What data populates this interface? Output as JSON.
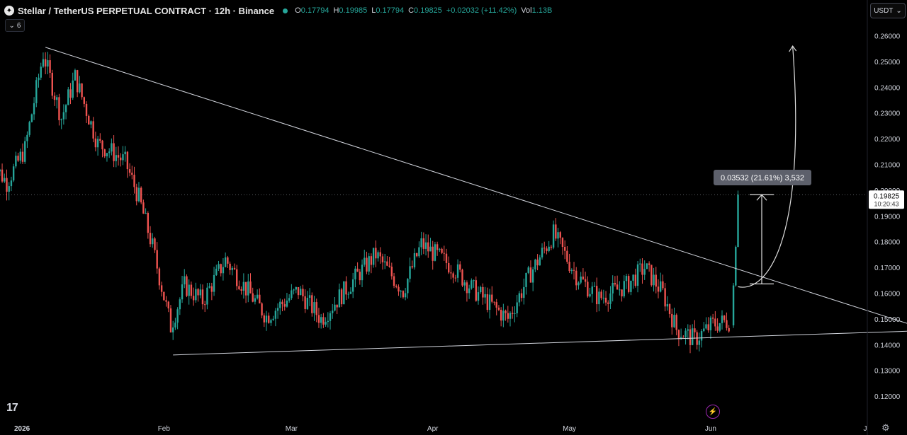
{
  "header": {
    "logo_icon": "stellar-logo-icon",
    "title": "Stellar / TetherUS PERPETUAL CONTRACT · 12h · Binance",
    "status_dot_color": "#26a69a",
    "ohlc": {
      "o_label": "O",
      "o": "0.17794",
      "h_label": "H",
      "h": "0.19985",
      "l_label": "L",
      "l": "0.17794",
      "c_label": "C",
      "c": "0.19825",
      "change": "+0.02032 (+11.42%)",
      "vol_label": "Vol",
      "vol": "1.13B"
    }
  },
  "indicator_toggle": {
    "icon": "chevron-down-icon",
    "count": "6"
  },
  "currency_select": {
    "value": "USDT",
    "icon": "chevron-down-icon"
  },
  "price_tag": {
    "price": "0.19825",
    "countdown": "10:20:43"
  },
  "measure_label": "0.03532 (21.61%) 3,532",
  "tv_logo": "17",
  "colors": {
    "up": "#26a69a",
    "down": "#ef5350",
    "trendline": "#d1d4dc",
    "background": "#000000"
  },
  "chart_data": {
    "type": "candlestick",
    "symbol": "XLMUSDT.P",
    "timeframe": "12h",
    "y_axis": {
      "ticks": [
        "0.26000",
        "0.25000",
        "0.24000",
        "0.23000",
        "0.22000",
        "0.21000",
        "0.20000",
        "0.19000",
        "0.18000",
        "0.17000",
        "0.16000",
        "0.15000",
        "0.14000",
        "0.13000",
        "0.12000"
      ],
      "range": [
        0.1155,
        0.2655
      ]
    },
    "x_axis": {
      "ticks": [
        "2026",
        "Feb",
        "Mar",
        "Apr",
        "May",
        "Jun",
        "J"
      ]
    },
    "current_price": 0.19825,
    "ohlc_anchors": [
      [
        "2025-12-25",
        0.213
      ],
      [
        "2025-12-29",
        0.203
      ],
      [
        "2026-01-02",
        0.216
      ],
      [
        "2026-01-06",
        0.253
      ],
      [
        "2026-01-10",
        0.228
      ],
      [
        "2026-01-13",
        0.244
      ],
      [
        "2026-01-18",
        0.218
      ],
      [
        "2026-01-21",
        0.215
      ],
      [
        "2026-01-24",
        0.211
      ],
      [
        "2026-01-27",
        0.197
      ],
      [
        "2026-01-30",
        0.178
      ],
      [
        "2026-02-03",
        0.147
      ],
      [
        "2026-02-06",
        0.163
      ],
      [
        "2026-02-10",
        0.157
      ],
      [
        "2026-02-15",
        0.173
      ],
      [
        "2026-02-19",
        0.163
      ],
      [
        "2026-02-24",
        0.151
      ],
      [
        "2026-03-03",
        0.161
      ],
      [
        "2026-03-08",
        0.15
      ],
      [
        "2026-03-16",
        0.167
      ],
      [
        "2026-03-20",
        0.175
      ],
      [
        "2026-03-26",
        0.161
      ],
      [
        "2026-03-30",
        0.179
      ],
      [
        "2026-04-06",
        0.17
      ],
      [
        "2026-04-10",
        0.162
      ],
      [
        "2026-04-18",
        0.15
      ],
      [
        "2026-04-23",
        0.168
      ],
      [
        "2026-04-28",
        0.183
      ],
      [
        "2026-05-03",
        0.167
      ],
      [
        "2026-05-08",
        0.158
      ],
      [
        "2026-05-14",
        0.163
      ],
      [
        "2026-05-18",
        0.17
      ],
      [
        "2026-05-22",
        0.16
      ],
      [
        "2026-05-25",
        0.146
      ],
      [
        "2026-05-29",
        0.142
      ],
      [
        "2026-06-02",
        0.148
      ],
      [
        "2026-06-05",
        0.149
      ]
    ],
    "last_candles": [
      {
        "date": "2026-06-06",
        "o": 0.1475,
        "h": 0.164,
        "l": 0.1465,
        "c": 0.163
      },
      {
        "date": "2026-06-06 12:00",
        "o": 0.163,
        "h": 0.1785,
        "l": 0.1625,
        "c": 0.178
      },
      {
        "date": "2026-06-07",
        "o": 0.17794,
        "h": 0.19985,
        "l": 0.17794,
        "c": 0.19825
      }
    ],
    "trendlines": [
      {
        "name": "descending-resistance",
        "from": [
          "2026-01-06",
          0.2555
        ],
        "to": [
          "2026-07-19",
          0.1455
        ]
      },
      {
        "name": "ascending-support",
        "from": [
          "2026-02-03",
          0.136
        ],
        "to": [
          "2026-07-19",
          0.1455
        ]
      }
    ],
    "projection_arrow": {
      "from": [
        "2026-06-07",
        0.1625
      ],
      "to": [
        "2026-06-19",
        0.256
      ]
    },
    "measure": {
      "from_price": 0.1636,
      "to_price": 0.19825,
      "change": "0.03532 (21.61%) 3,532"
    }
  }
}
